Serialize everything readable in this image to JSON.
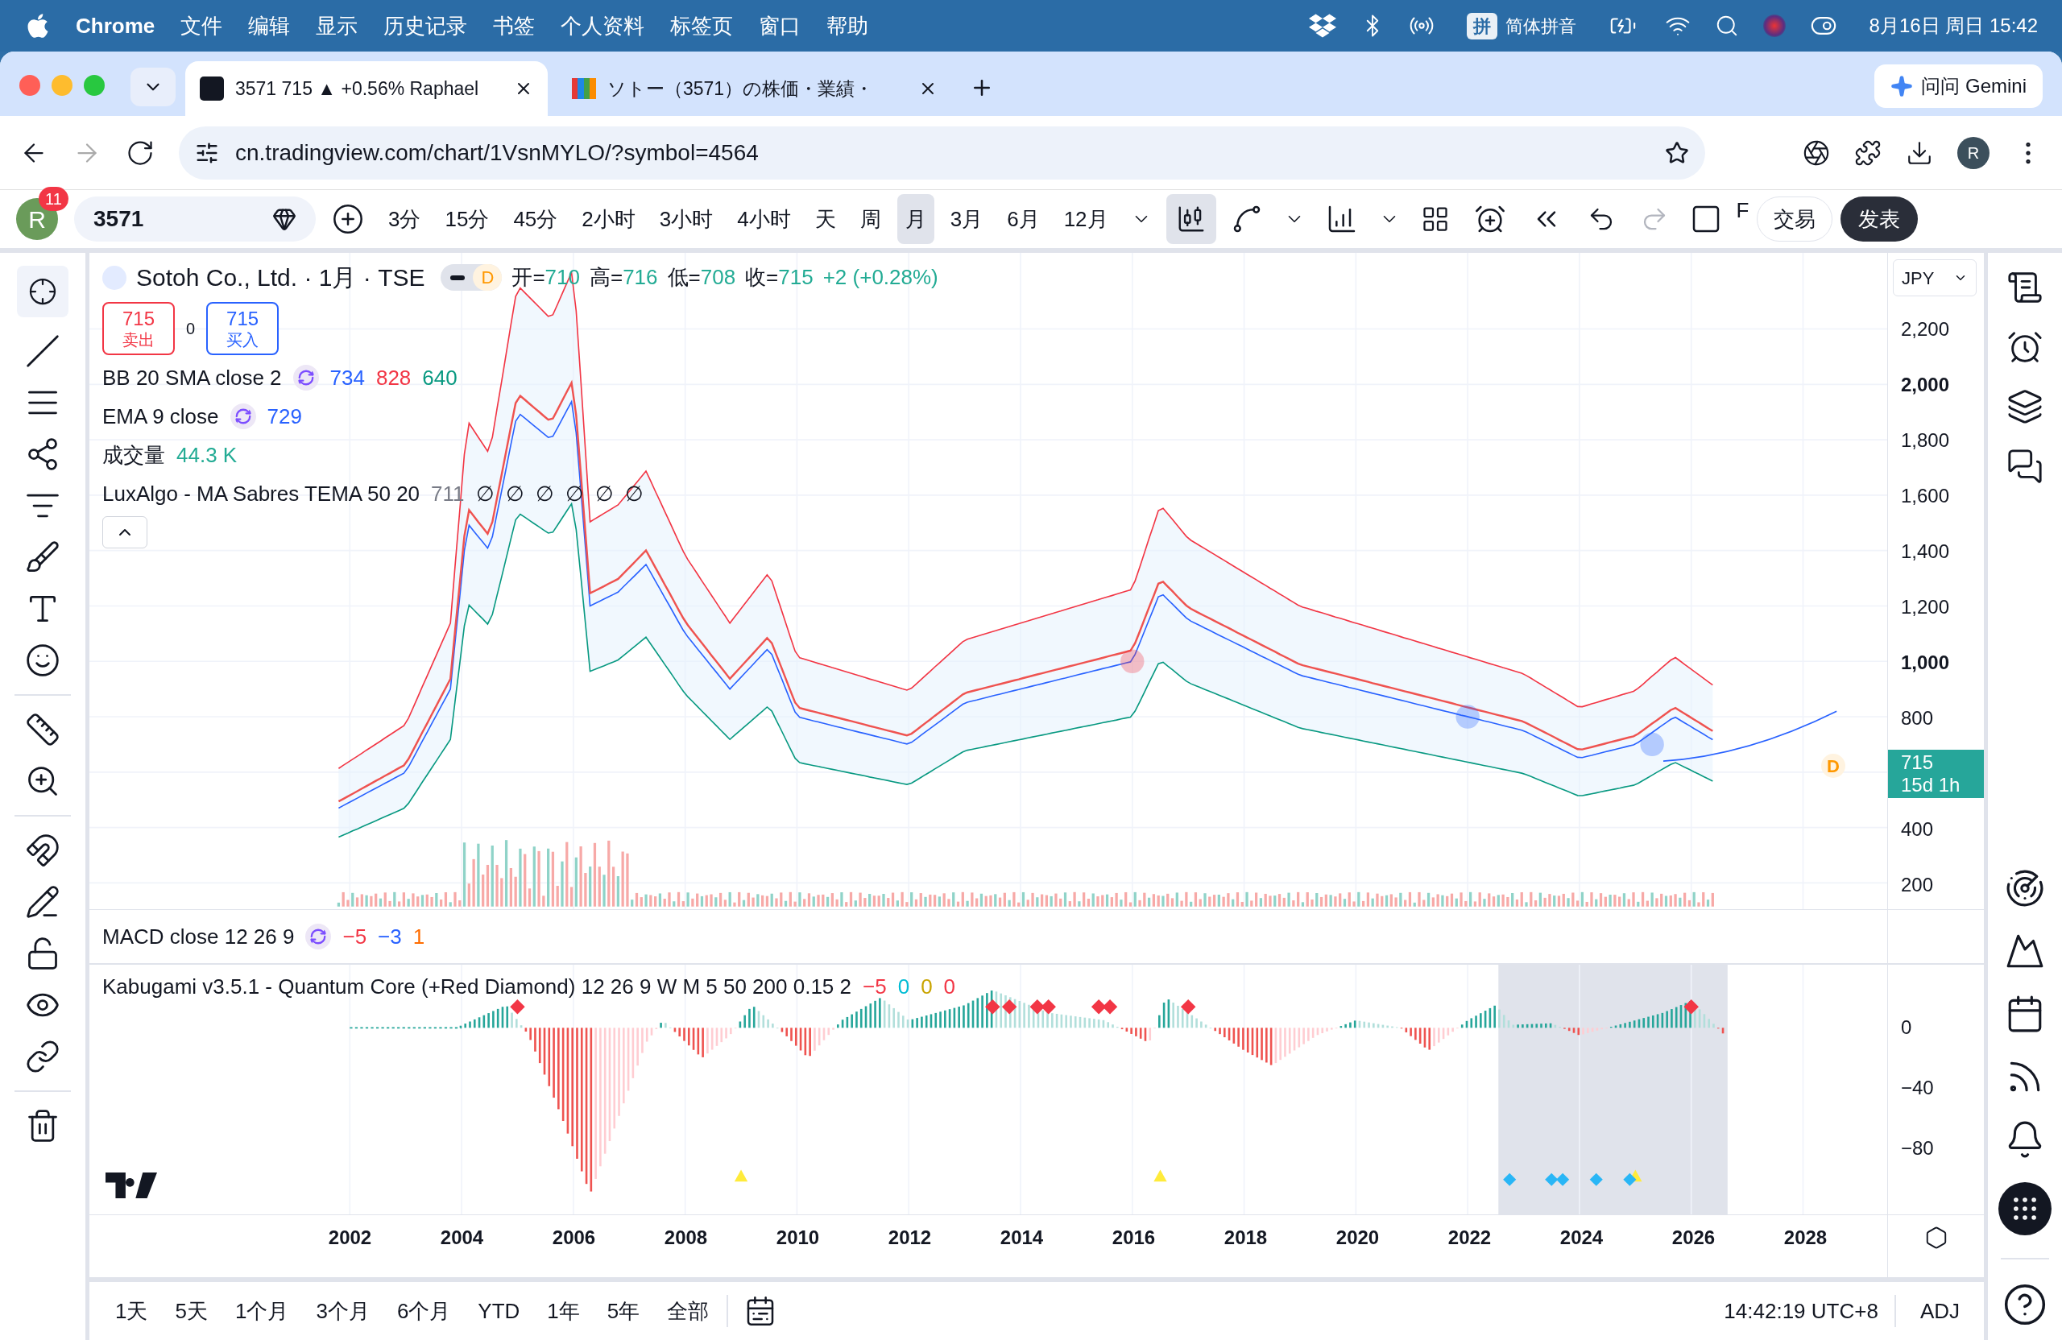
{
  "menubar": {
    "app": "Chrome",
    "items": [
      "文件",
      "编辑",
      "显示",
      "历史记录",
      "书签",
      "个人资料",
      "标签页",
      "窗口",
      "帮助"
    ],
    "ime_badge": "拼",
    "input_method": "简体拼音",
    "datetime": "8月16日 周日 15:42"
  },
  "tabs": [
    {
      "title": "3571 715 ▲ +0.56% Raphael",
      "selected": true
    },
    {
      "title": "ソトー（3571）の株価・業績・",
      "selected": false
    }
  ],
  "gemini": "问问 Gemini",
  "address": "cn.tradingview.com/chart/1VsnMYLO/?symbol=4564",
  "profile": "R",
  "toolbar": {
    "avatar": "R",
    "notifications": "11",
    "symbol": "3571",
    "intervals": [
      {
        "label": "3分",
        "selected": false
      },
      {
        "label": "15分",
        "selected": false
      },
      {
        "label": "45分",
        "selected": false
      },
      {
        "label": "2小时",
        "selected": false
      },
      {
        "label": "3小时",
        "selected": false
      },
      {
        "label": "4小时",
        "selected": false
      },
      {
        "label": "天",
        "selected": false
      },
      {
        "label": "周",
        "selected": false
      },
      {
        "label": "月",
        "selected": true
      },
      {
        "label": "3月",
        "selected": false
      },
      {
        "label": "6月",
        "selected": false
      },
      {
        "label": "12月",
        "selected": false
      }
    ],
    "cut_label": "F",
    "trade": "交易",
    "publish": "发表"
  },
  "legend": {
    "title": "Sotoh Co., Ltd. · 1月 · TSE",
    "badge": "D",
    "ohlc": [
      {
        "label": "开=",
        "value": "710"
      },
      {
        "label": "高=",
        "value": "716"
      },
      {
        "label": "低=",
        "value": "708"
      },
      {
        "label": "收=",
        "value": "715"
      }
    ],
    "change": "+2 (+0.28%)",
    "sell_price": "715",
    "sell": "卖出",
    "spread": "0",
    "buy_price": "715",
    "buy": "买入",
    "indicators": [
      {
        "name": "BB 20 SMA close 2",
        "values": [
          {
            "text": "734",
            "color": "#2962ff"
          },
          {
            "text": "828",
            "color": "#f23645"
          },
          {
            "text": "640",
            "color": "#089981"
          }
        ]
      },
      {
        "name": "EMA 9 close",
        "values": [
          {
            "text": "729",
            "color": "#2962ff"
          }
        ]
      },
      {
        "name": "成交量",
        "values": [
          {
            "text": "44.3 K",
            "color": "#22ab94"
          }
        ]
      },
      {
        "name": "LuxAlgo - MA Sabres TEMA 50 20",
        "values": [
          {
            "text": "711",
            "color": "#787b86"
          },
          {
            "text": "∅",
            "color": "#131722"
          },
          {
            "text": "∅",
            "color": "#131722"
          },
          {
            "text": "∅",
            "color": "#131722"
          },
          {
            "text": "∅",
            "color": "#131722"
          },
          {
            "text": "∅",
            "color": "#131722"
          },
          {
            "text": "∅",
            "color": "#131722"
          }
        ]
      }
    ]
  },
  "dividend_marker": "D",
  "price_axis": {
    "currency": "JPY",
    "labels": [
      {
        "kind": "tick",
        "text": "2,200",
        "bold": false
      },
      {
        "kind": "tick",
        "text": "2,000",
        "bold": true
      },
      {
        "kind": "tick",
        "text": "1,800",
        "bold": false
      },
      {
        "kind": "tick",
        "text": "1,600",
        "bold": false
      },
      {
        "kind": "tick",
        "text": "1,400",
        "bold": false
      },
      {
        "kind": "tick",
        "text": "1,200",
        "bold": false
      },
      {
        "kind": "tick",
        "text": "1,000",
        "bold": true
      },
      {
        "kind": "tick",
        "text": "800",
        "bold": false
      },
      {
        "kind": "last",
        "text": "715",
        "countdown": "15d 1h"
      },
      {
        "kind": "tick",
        "text": "400",
        "bold": false
      },
      {
        "kind": "tick",
        "text": "200",
        "bold": false
      }
    ]
  },
  "macd": {
    "name": "MACD close 12 26 9",
    "values": [
      {
        "text": "−5",
        "color": "#f23645"
      },
      {
        "text": "−3",
        "color": "#2962ff"
      },
      {
        "text": "1",
        "color": "#ff6d00"
      }
    ]
  },
  "kabugami": {
    "name": "Kabugami v3.5.1 - Quantum Core (+Red Diamond) 12 26 9 W M 5 50 200 0.15 2",
    "values": [
      {
        "text": "−5",
        "color": "#f23645"
      },
      {
        "text": "0",
        "color": "#00bcd4"
      },
      {
        "text": "0",
        "color": "#c9a400"
      },
      {
        "text": "0",
        "color": "#f23645"
      }
    ],
    "axis": [
      "0",
      "−40",
      "−80"
    ]
  },
  "time_axis": [
    "2002",
    "2004",
    "2006",
    "2008",
    "2010",
    "2012",
    "2014",
    "2016",
    "2018",
    "2020",
    "2022",
    "2024",
    "2026",
    "2028"
  ],
  "ranges": [
    "1天",
    "5天",
    "1个月",
    "3个月",
    "6个月",
    "YTD",
    "1年",
    "5年",
    "全部"
  ],
  "clock": "14:42:19 UTC+8",
  "adj": "ADJ"
}
